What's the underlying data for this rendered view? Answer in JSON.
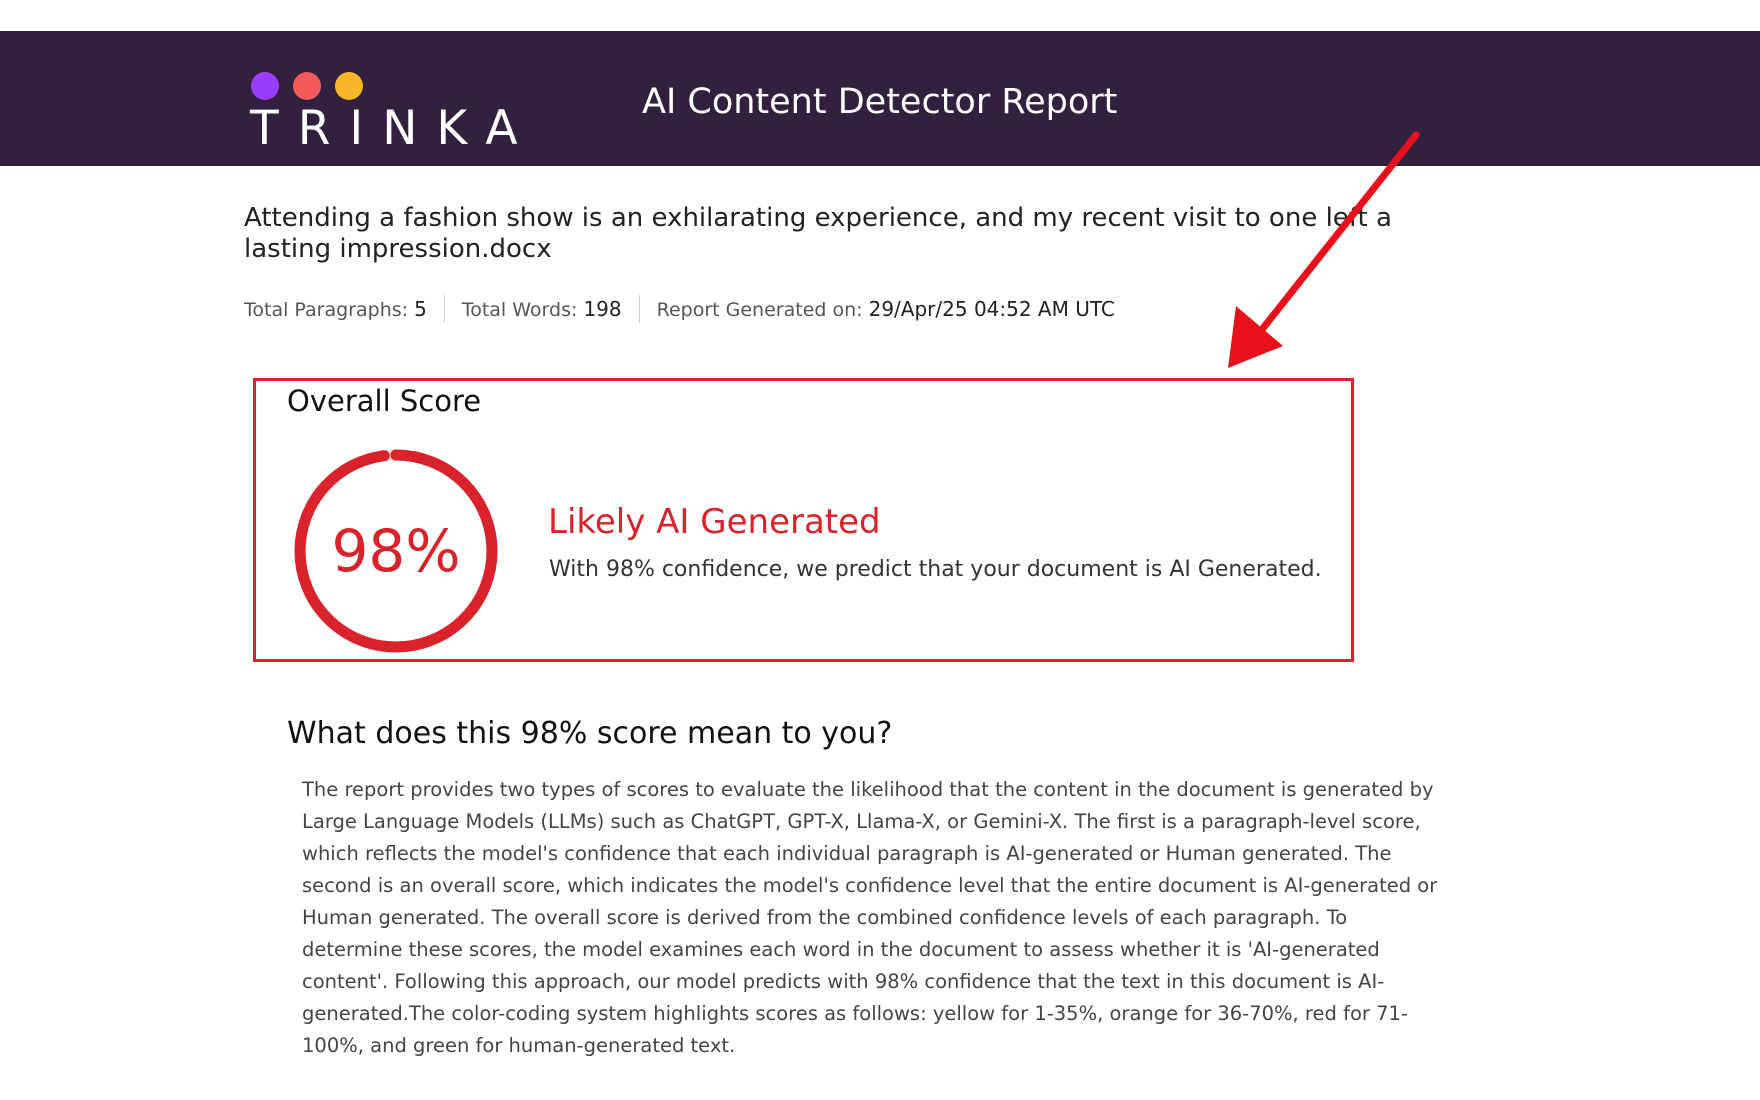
{
  "header": {
    "logo_text": "TRINKA",
    "title": "AI Content Detector Report",
    "colors": {
      "background": "#32203f",
      "dot_purple": "#9b3dff",
      "dot_red": "#f25a5a",
      "dot_yellow": "#f7b52a"
    }
  },
  "document": {
    "name": "Attending a fashion show is an exhilarating experience, and my recent visit to one left a lasting impression.docx"
  },
  "meta": {
    "paragraphs_label": "Total Paragraphs:",
    "paragraphs_value": "5",
    "words_label": "Total Words:",
    "words_value": "198",
    "generated_label": "Report Generated on:",
    "generated_value": "29/Apr/25 04:52 AM UTC"
  },
  "overall": {
    "heading": "Overall Score",
    "score_text": "98%",
    "score_fraction": 0.98,
    "verdict": "Likely AI Generated",
    "description": "With 98% confidence, we predict that your document is AI Generated.",
    "accent_color": "#d9222a"
  },
  "explanation": {
    "title": "What does this 98% score mean to you?",
    "body": "The report provides two types of scores to evaluate the likelihood that the content in the document is generated by Large Language Models (LLMs) such as ChatGPT, GPT-X, Llama-X, or Gemini-X. The first is a paragraph-level score, which reflects the model's confidence that each individual paragraph is AI-generated or Human generated. The second is an overall score, which indicates the model's confidence level that the entire document is AI-generated or Human generated. The overall score is derived from the combined confidence levels of each paragraph. To determine these scores, the model examines each word in the document to assess whether it is 'AI-generated content'. Following this approach, our model predicts with 98% confidence that the text in this document is AI-generated.The color-coding system highlights scores as follows: yellow for 1-35%, orange for 36-70%, red for 71-100%, and green for human-generated text."
  },
  "annotation": {
    "arrow_color": "#e8101a",
    "highlight_icon": "red-arrow-icon"
  }
}
